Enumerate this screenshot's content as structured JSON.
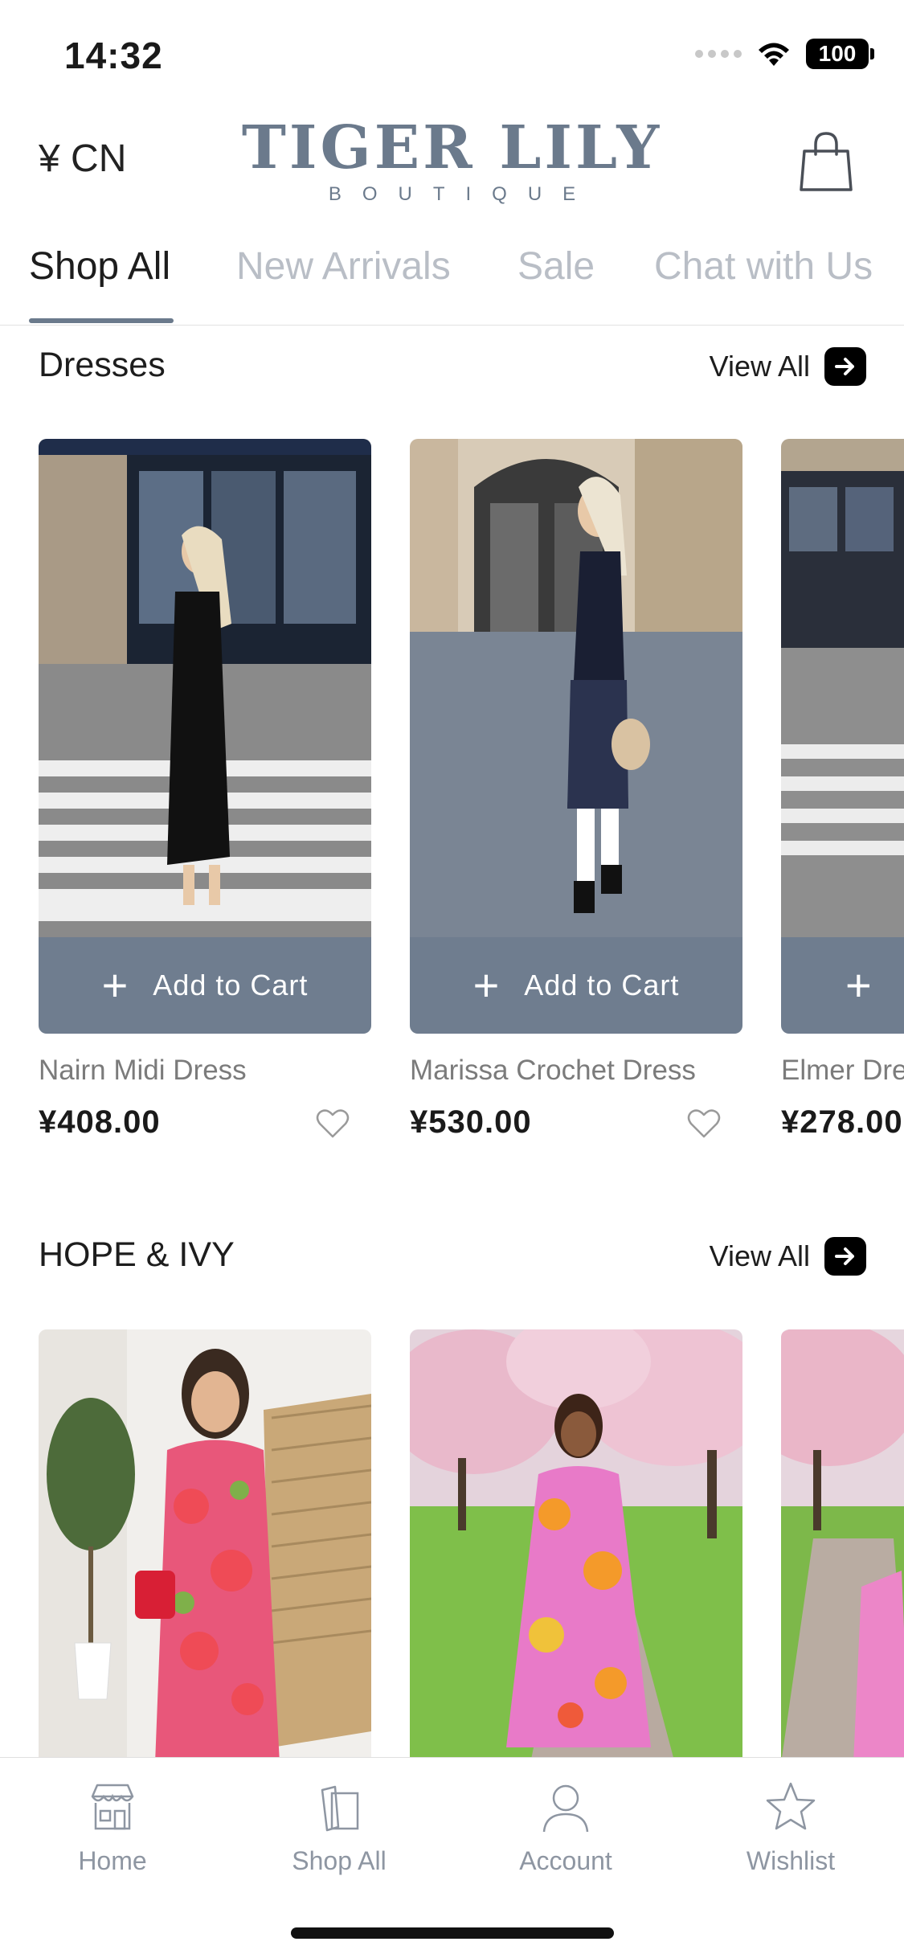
{
  "status": {
    "time": "14:32",
    "battery": "100"
  },
  "header": {
    "currency": "¥ CN",
    "logo_title": "TIGER LILY",
    "logo_subtitle": "BOUTIQUE"
  },
  "tabs": [
    {
      "label": "Shop All",
      "active": true
    },
    {
      "label": "New Arrivals",
      "active": false
    },
    {
      "label": "Sale",
      "active": false
    },
    {
      "label": "Chat with Us",
      "active": false
    }
  ],
  "sections": [
    {
      "title": "Dresses",
      "view_all": "View All",
      "products": [
        {
          "name": "Nairn Midi Dress",
          "price": "¥408.00",
          "add_to_cart": "Add to Cart"
        },
        {
          "name": "Marissa Crochet Dress",
          "price": "¥530.00",
          "add_to_cart": "Add to Cart"
        },
        {
          "name": "Elmer Dre",
          "price": "¥278.00",
          "add_to_cart": ""
        }
      ]
    },
    {
      "title": "HOPE & IVY",
      "view_all": "View All"
    }
  ],
  "bottom_nav": [
    {
      "label": "Home",
      "icon": "storefront-icon"
    },
    {
      "label": "Shop All",
      "icon": "shopping-bags-icon"
    },
    {
      "label": "Account",
      "icon": "person-icon"
    },
    {
      "label": "Wishlist",
      "icon": "star-icon"
    }
  ],
  "colors": {
    "brand": "#6b7a8c",
    "button": "#6f7d8f",
    "inactive_tab": "#b9bec6"
  }
}
